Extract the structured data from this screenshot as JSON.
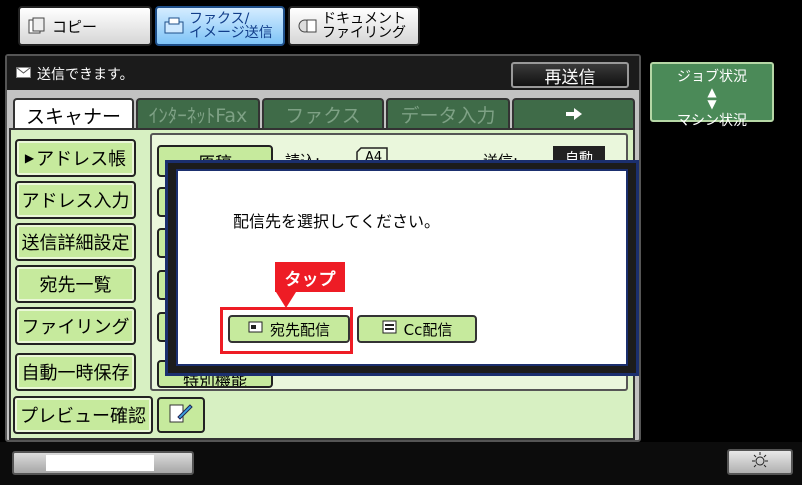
{
  "mode_tabs": [
    {
      "label": "コピー",
      "icon": "copy-icon"
    },
    {
      "label": "ファクス/\nイメージ送信",
      "icon": "fax-icon"
    },
    {
      "label": "ドキュメント\nファイリング",
      "icon": "document-filing-icon"
    }
  ],
  "status": {
    "message": "送信できます。",
    "resend_label": "再送信"
  },
  "tabs": [
    "スキャナー",
    "ｲﾝﾀｰﾈｯﾄFax",
    "ファクス",
    "データ入力"
  ],
  "left_buttons": [
    "アドレス帳",
    "アドレス入力",
    "送信詳細設定",
    "宛先一覧",
    "ファイリング",
    "自動一時保存",
    "プレビュー確認"
  ],
  "scan_area": {
    "original_label": "原稿",
    "read_label": "読込:",
    "read_size": "A4",
    "send_label": "送信:",
    "send_value": "自動",
    "special_label": "特別機能"
  },
  "dialog": {
    "message": "配信先を選択してください。",
    "to_button": "宛先配信",
    "cc_button": "Cc配信"
  },
  "annotation": {
    "tap_label": "タップ"
  },
  "right_panel": {
    "job_status": "ジョブ状況",
    "machine_status": "マシン状況"
  },
  "colors": {
    "annotation_red": "#ee1c25",
    "button_green": "#c6ea9d",
    "active_mode_blue": "#7fc4f7"
  }
}
